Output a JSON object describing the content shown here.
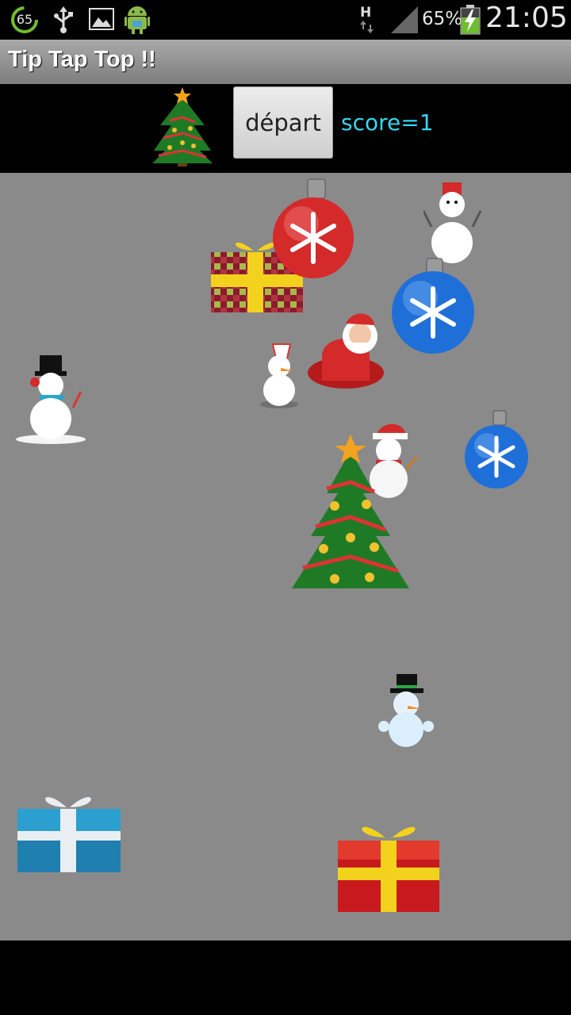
{
  "status_bar": {
    "notification_badge": "65",
    "battery_percent": "65%",
    "time": "21:05",
    "network_type": "H",
    "icons": [
      "notification-65-icon",
      "usb-icon",
      "image-icon",
      "android-icon",
      "network-h-icon",
      "signal-icon",
      "battery-charging-icon"
    ]
  },
  "app": {
    "title": "Tip Tap Top !!"
  },
  "toolbar": {
    "start_button_label": "départ",
    "score_text": "score=1",
    "score_color": "#35d7f0"
  },
  "game": {
    "background_color": "#8a8a8a",
    "sprites": [
      "christmas-tree",
      "gift-box",
      "ornament-red",
      "ornament-blue",
      "snowman",
      "santa"
    ]
  }
}
